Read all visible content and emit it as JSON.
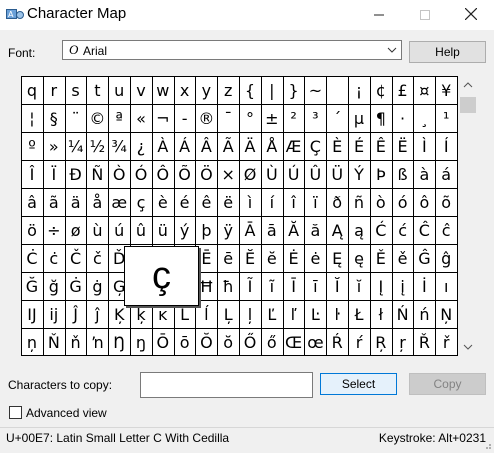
{
  "window": {
    "title": "Character Map",
    "icons": {
      "app": "character-map-app-icon",
      "minimize": "minimize-icon",
      "maximize": "maximize-icon",
      "close": "close-icon"
    }
  },
  "font": {
    "label": "Font:",
    "value": "Arial",
    "type_icon": "O"
  },
  "help": {
    "label": "Help"
  },
  "grid": {
    "columns": 20,
    "rows": 10,
    "characters": [
      [
        "q",
        "r",
        "s",
        "t",
        "u",
        "v",
        "w",
        "x",
        "y",
        "z",
        "{",
        "|",
        "}",
        "~",
        " ",
        "¡",
        "¢",
        "£",
        "¤",
        "¥"
      ],
      [
        "¦",
        "§",
        "¨",
        "©",
        "ª",
        "«",
        "¬",
        "-",
        "®",
        "¯",
        "°",
        "±",
        "²",
        "³",
        "´",
        "µ",
        "¶",
        "·",
        "¸",
        "¹"
      ],
      [
        "º",
        "»",
        "¼",
        "½",
        "¾",
        "¿",
        "À",
        "Á",
        "Â",
        "Ã",
        "Ä",
        "Å",
        "Æ",
        "Ç",
        "È",
        "É",
        "Ê",
        "Ë",
        "Ì",
        "Í"
      ],
      [
        "Î",
        "Ï",
        "Ð",
        "Ñ",
        "Ò",
        "Ó",
        "Ô",
        "Õ",
        "Ö",
        "×",
        "Ø",
        "Ù",
        "Ú",
        "Û",
        "Ü",
        "Ý",
        "Þ",
        "ß",
        "à",
        "á"
      ],
      [
        "â",
        "ã",
        "ä",
        "å",
        "æ",
        "ç",
        "è",
        "é",
        "ê",
        "ë",
        "ì",
        "í",
        "î",
        "ï",
        "ð",
        "ñ",
        "ò",
        "ó",
        "ô",
        "õ"
      ],
      [
        "ö",
        "÷",
        "ø",
        "ù",
        "ú",
        "û",
        "ü",
        "ý",
        "þ",
        "ÿ",
        "Ā",
        "ā",
        "Ă",
        "ă",
        "Ą",
        "ą",
        "Ć",
        "ć",
        "Ĉ",
        "ĉ"
      ],
      [
        "Ċ",
        "ċ",
        "Č",
        "č",
        "Ď",
        "ď",
        "Đ",
        "đ",
        "Ē",
        "ē",
        "Ĕ",
        "ĕ",
        "Ė",
        "ė",
        "Ę",
        "ę",
        "Ě",
        "ě",
        "Ĝ",
        "ĝ"
      ],
      [
        "Ğ",
        "ğ",
        "Ġ",
        "ġ",
        "Ģ",
        "ģ",
        "Ĥ",
        "ĥ",
        "Ħ",
        "ħ",
        "Ĩ",
        "ĩ",
        "Ī",
        "ī",
        "Ĭ",
        "ĭ",
        "Į",
        "į",
        "İ",
        "ı"
      ],
      [
        "Ĳ",
        "ĳ",
        "Ĵ",
        "ĵ",
        "Ķ",
        "ķ",
        "ĸ",
        "Ĺ",
        "ĺ",
        "Ļ",
        "ļ",
        "Ľ",
        "ľ",
        "Ŀ",
        "ŀ",
        "Ł",
        "ł",
        "Ń",
        "ń",
        "Ņ"
      ],
      [
        "ņ",
        "Ň",
        "ň",
        "ŉ",
        "Ŋ",
        "ŋ",
        "Ō",
        "ō",
        "Ŏ",
        "ŏ",
        "Ő",
        "ő",
        "Œ",
        "œ",
        "Ŕ",
        "ŕ",
        "Ŗ",
        "ŗ",
        "Ř",
        "ř"
      ]
    ],
    "selected": "ç",
    "magnified": "ç"
  },
  "scrollbar": {
    "up_icon": "chevron-up-icon",
    "down_icon": "chevron-down-icon"
  },
  "copy": {
    "label": "Characters to copy:",
    "value": "",
    "select_label": "Select",
    "copy_label": "Copy"
  },
  "advanced": {
    "label": "Advanced view",
    "checked": false
  },
  "status": {
    "description": "U+00E7: Latin Small Letter C With Cedilla",
    "keystroke": "Keystroke: Alt+0231"
  }
}
